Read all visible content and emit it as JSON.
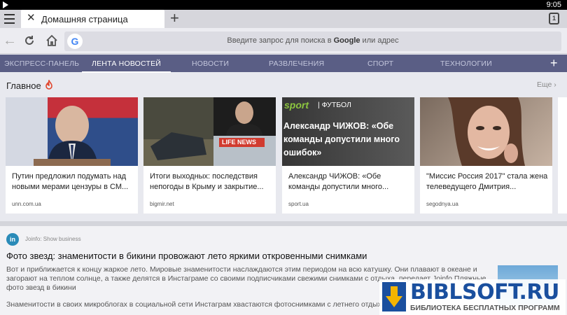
{
  "status": {
    "time": "9:05"
  },
  "tab": {
    "title": "Домашняя страница",
    "close_symbol": "✕",
    "new_tab_symbol": "+",
    "tabs_count": "1"
  },
  "address": {
    "placeholder_before": "Введите запрос для поиска в ",
    "placeholder_brand": "Google",
    "placeholder_after": " или адрес"
  },
  "nav": {
    "items": [
      {
        "label": "ЭКСПРЕСС-ПАНЕЛЬ"
      },
      {
        "label": "ЛЕНТА НОВОСТЕЙ"
      },
      {
        "label": "НОВОСТИ"
      },
      {
        "label": "РАЗВЛЕЧЕНИЯ"
      },
      {
        "label": "СПОРТ"
      },
      {
        "label": "ТЕХНОЛОГИИ"
      }
    ],
    "plus": "+"
  },
  "section": {
    "title": "Главное",
    "more": "Еще ›"
  },
  "cards": [
    {
      "text": "Путин предложил подумать над новыми мерами цензуры в СМ...",
      "source": "unn.com.ua"
    },
    {
      "text": "Итоги выходных: последствия непогоды в Крыму и закрытие...",
      "source": "bigmir.net",
      "img_label": "LIFE NEWS"
    },
    {
      "text": "Александр ЧИЖОВ: «Обе команды допустили много...",
      "source": "sport.ua",
      "img_brand": "sport",
      "img_tag": "| ФУТБОЛ",
      "img_headline": "Александр ЧИЖОВ: «Обе команды допустили много ошибок»"
    },
    {
      "text": "\"Миссис Россия 2017\" стала жена телеведущего Дмитрия...",
      "source": "segodnya.ua"
    }
  ],
  "article": {
    "logo": "in",
    "source": "Joinfo: Show business",
    "headline": "Фото звезд: знаменитости в бикини провожают лето яркими откровенными снимками",
    "p1": "Вот и приближается к концу жаркое лето. Мировые знаменитости наслаждаются этим периодом на всю катушку. Они плавают в океане и загорают на теплом солнце, а также делятся в Инстаграме со своими подписчиками свежими снимками с отдыха, передает Joinfo Пляжные фото звезд в бикини",
    "p2": "Знаменитости в своих микроблогах в социальной сети Инстаграм хвастаются фотоснимками с летнего отдыха"
  },
  "watermark": {
    "brand": "BIBLSOFT.RU",
    "tagline": "БИБЛИОТЕКА БЕСПЛАТНЫХ ПРОГРАММ"
  }
}
